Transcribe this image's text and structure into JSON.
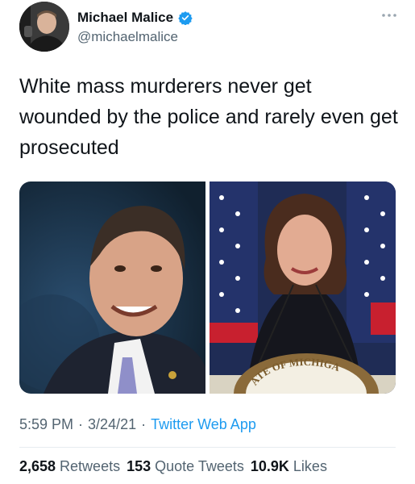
{
  "user": {
    "display_name": "Michael Malice",
    "handle": "@michaelmalice",
    "verified": true
  },
  "tweet": {
    "text": "White mass murderers never get wounded by the police and rarely even get prosecuted"
  },
  "seal_text": "ATE OF MICHIGA",
  "meta": {
    "time": "5:59 PM",
    "sep1": "·",
    "date": "3/24/21",
    "sep2": "·",
    "source": "Twitter Web App"
  },
  "stats": {
    "retweets_count": "2,658",
    "retweets_label": "Retweets",
    "quotes_count": "153",
    "quotes_label": "Quote Tweets",
    "likes_count": "10.9K",
    "likes_label": "Likes"
  },
  "colors": {
    "accent": "#1d9bf0",
    "secondary_text": "#536471"
  }
}
